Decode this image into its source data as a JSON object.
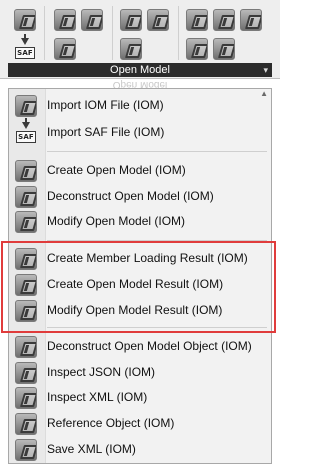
{
  "ribbon": {
    "panel_title": "Open Model",
    "panel_menu_caret": "▾",
    "reflection_text": "Open Model"
  },
  "menu": {
    "scroll_up_arrow": "▲",
    "items": [
      {
        "label": "Import IOM File (IOM)",
        "icon": "iom-icon"
      },
      {
        "label": "Import SAF File (IOM)",
        "icon": "saf-import-icon"
      },
      {
        "label": "Create Open Model (IOM)",
        "icon": "iom-icon"
      },
      {
        "label": "Deconstruct Open Model (IOM)",
        "icon": "iom-icon"
      },
      {
        "label": "Modify Open Model (IOM)",
        "icon": "iom-icon"
      },
      {
        "label": "Create Member Loading Result (IOM)",
        "icon": "iom-icon"
      },
      {
        "label": "Create Open Model Result (IOM)",
        "icon": "iom-icon"
      },
      {
        "label": "Modify Open Model Result (IOM)",
        "icon": "iom-icon"
      },
      {
        "label": "Deconstruct Open Model Object (IOM)",
        "icon": "iom-icon"
      },
      {
        "label": "Inspect JSON (IOM)",
        "icon": "iom-icon"
      },
      {
        "label": "Inspect XML (IOM)",
        "icon": "iom-icon"
      },
      {
        "label": "Reference Object (IOM)",
        "icon": "iom-icon"
      },
      {
        "label": "Save XML (IOM)",
        "icon": "iom-icon"
      }
    ]
  },
  "saf_icon_text": "SAF",
  "colors": {
    "highlight": "#e03c3c",
    "panel_bar": "#2b2b2b"
  }
}
